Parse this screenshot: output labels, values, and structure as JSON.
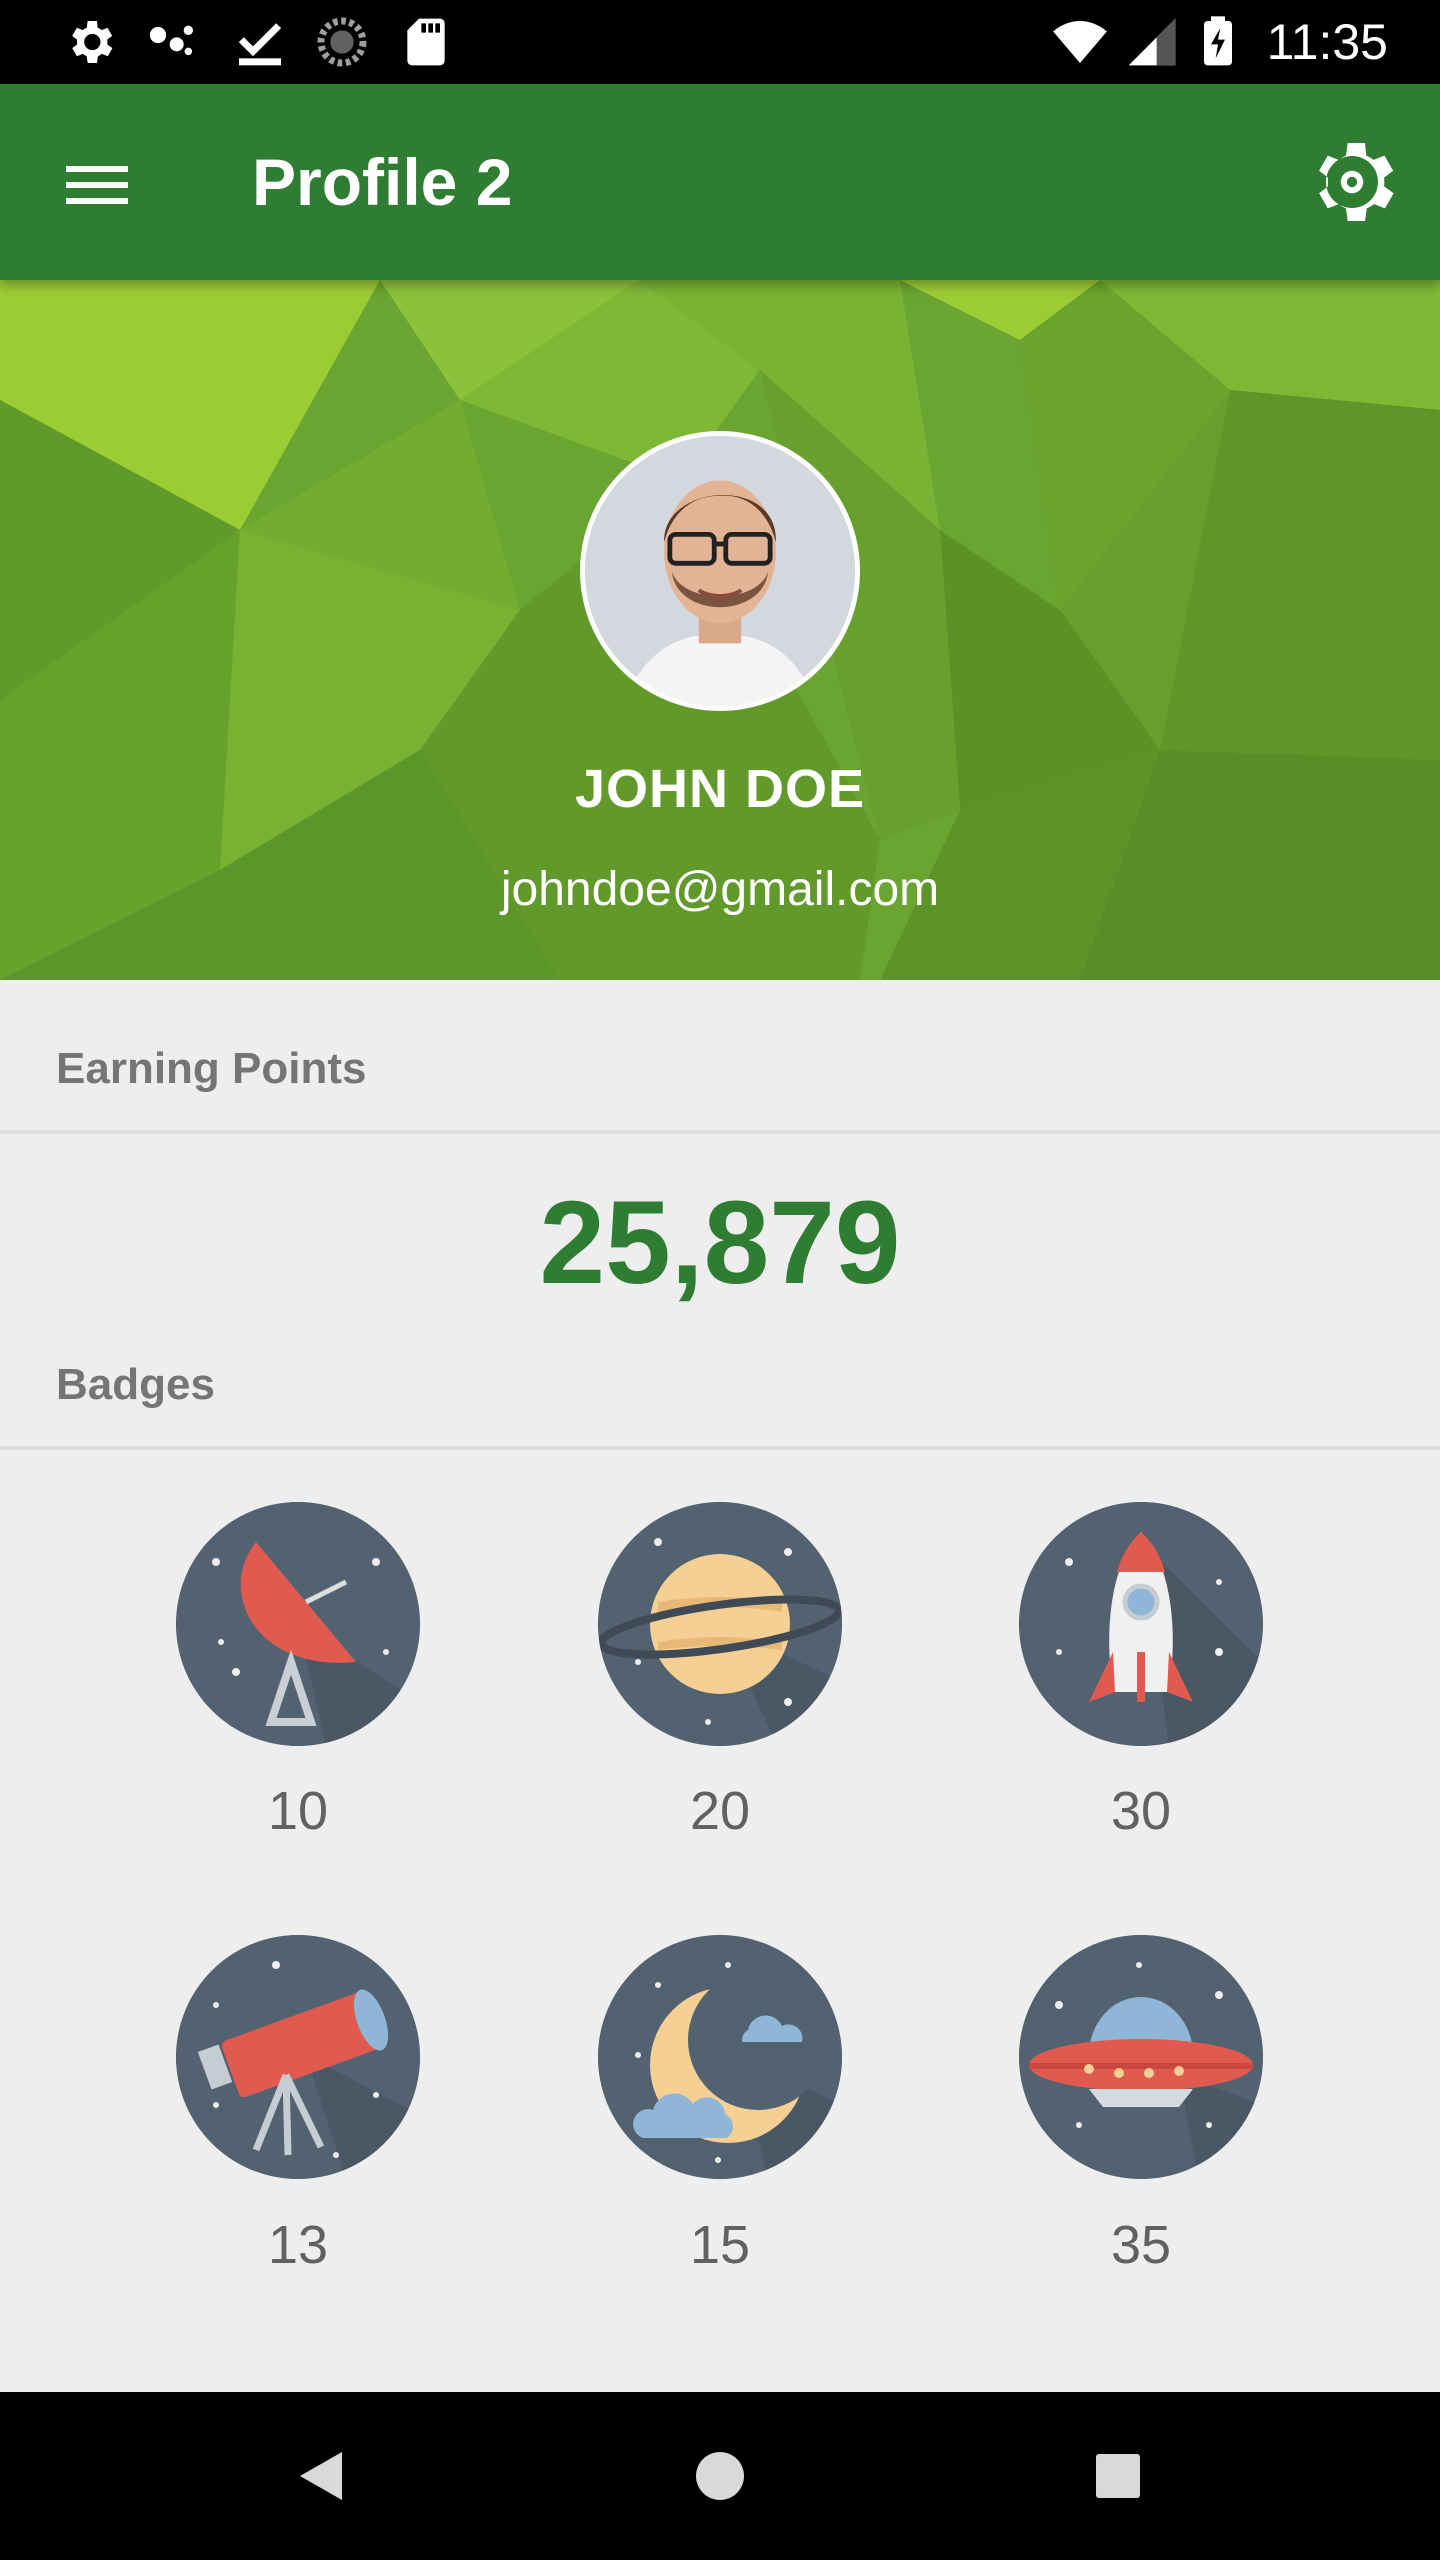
{
  "status_bar": {
    "time": "11:35",
    "left_icons": [
      "gear-icon",
      "dots-icon",
      "download-done-icon",
      "loading-icon",
      "sd-card-icon"
    ],
    "right_icons": [
      "wifi-icon",
      "signal-icon",
      "battery-charging-icon"
    ]
  },
  "app_bar": {
    "title": "Profile 2",
    "menu_icon": "menu-icon",
    "settings_icon": "gear-icon"
  },
  "profile": {
    "name": "JOHN DOE",
    "email": "johndoe@gmail.com"
  },
  "earning": {
    "label": "Earning Points",
    "value": "25,879"
  },
  "badges": {
    "label": "Badges",
    "items": [
      {
        "icon": "satellite-dish-icon",
        "count": "10"
      },
      {
        "icon": "planet-icon",
        "count": "20"
      },
      {
        "icon": "rocket-icon",
        "count": "30"
      },
      {
        "icon": "telescope-icon",
        "count": "13"
      },
      {
        "icon": "moon-cloud-icon",
        "count": "15"
      },
      {
        "icon": "ufo-icon",
        "count": "35"
      }
    ]
  },
  "colors": {
    "primary": "#2e7d32",
    "banner_light": "#8ac43a",
    "banner_dark": "#558b2f",
    "badge_bg": "#536270",
    "content_bg": "#eeeeee"
  },
  "nav_bar": {
    "buttons": [
      "back-icon",
      "home-icon",
      "recents-icon"
    ]
  }
}
